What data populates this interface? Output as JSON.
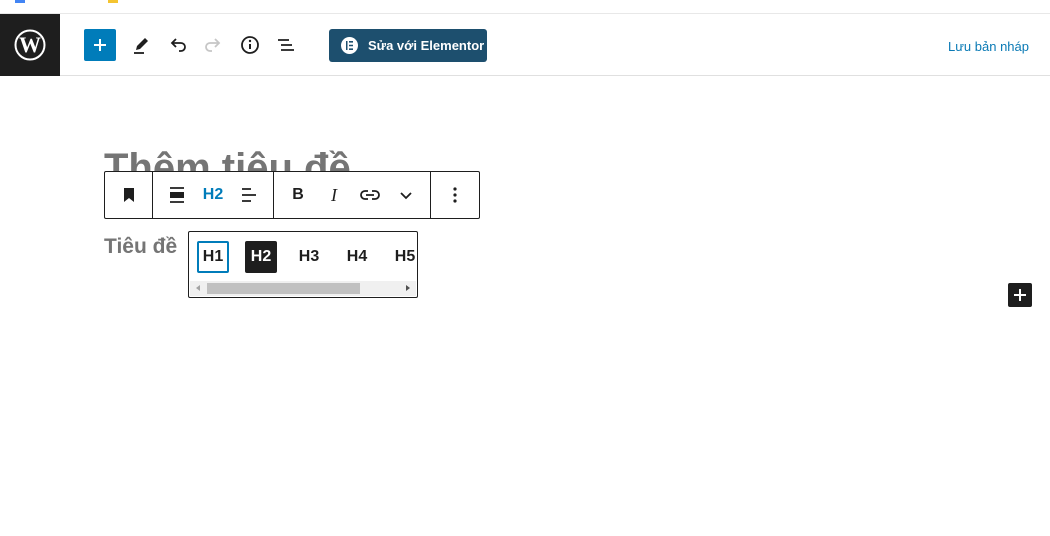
{
  "topbar": {
    "elementor_label": "Sửa với Elementor",
    "save_draft_label": "Lưu bản nháp"
  },
  "editor": {
    "title_placeholder": "Thêm tiêu đề",
    "heading_text": "Tiêu đề"
  },
  "toolbar": {
    "heading_level": "H2",
    "bold_label": "B",
    "italic_label": "I"
  },
  "heading_levels": [
    "H1",
    "H2",
    "H3",
    "H4",
    "H5"
  ],
  "colors": {
    "accent": "#007cba",
    "elementor": "#1d4f6e",
    "dark": "#1e1e1e",
    "placeholder_text": "#757575"
  }
}
